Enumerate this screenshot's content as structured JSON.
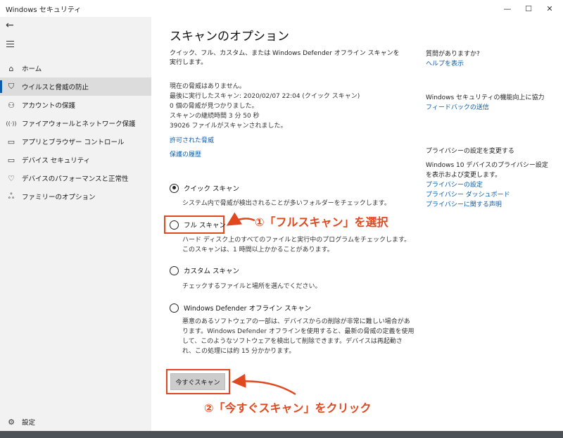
{
  "window": {
    "title": "Windows セキュリティ"
  },
  "titlebar_controls": {
    "minimize": "—",
    "maximize": "☐",
    "close": "✕"
  },
  "sidebar": {
    "back_icon": "←",
    "items": [
      {
        "icon": "⌂",
        "label": "ホーム"
      },
      {
        "icon": "⛉",
        "label": "ウイルスと脅威の防止"
      },
      {
        "icon": "⚇",
        "label": "アカウントの保護"
      },
      {
        "icon": "((·))",
        "label": "ファイアウォールとネットワーク保護"
      },
      {
        "icon": "▭",
        "label": "アプリとブラウザー コントロール"
      },
      {
        "icon": "▭",
        "label": "デバイス セキュリティ"
      },
      {
        "icon": "♡",
        "label": "デバイスのパフォーマンスと正常性"
      },
      {
        "icon": "ஃ",
        "label": "ファミリーのオプション"
      }
    ],
    "settings": {
      "icon": "⚙",
      "label": "設定"
    }
  },
  "main": {
    "title": "スキャンのオプション",
    "description": "クイック、フル、カスタム、または Windows Defender オフライン スキャンを実行します。",
    "status_lines": [
      "現在の脅威はありません。",
      "最後に実行したスキャン: 2020/02/07 22:04 (クイック スキャン)",
      "0 個の脅威が見つかりました。",
      "スキャンの継続時間 3 分 50 秒",
      "39026 ファイルがスキャンされました。"
    ],
    "allowed_threats_link": "許可された脅威",
    "history_link": "保護の履歴",
    "options": [
      {
        "label": "クイック スキャン",
        "selected": true,
        "desc": "システム内で脅威が検出されることが多いフォルダーをチェックします。"
      },
      {
        "label": "フル スキャン",
        "selected": false,
        "desc": "ハード ディスク上のすべてのファイルと実行中のプログラムをチェックします。このスキャンは、1 時間以上かかることがあります。"
      },
      {
        "label": "カスタム スキャン",
        "selected": false,
        "desc": "チェックするファイルと場所を選んでください。"
      },
      {
        "label": "Windows Defender オフライン スキャン",
        "selected": false,
        "desc": "悪意のあるソフトウェアの一部は、デバイスからの削除が非常に難しい場合があります。Windows Defender オフラインを使用すると、最新の脅威の定義を使用して、このようなソフトウェアを検出して削除できます。デバイスは再起動され、この処理には約 15 分かかります。"
      }
    ],
    "scan_button": "今すぐスキャン"
  },
  "annotations": {
    "step1": "①「フルスキャン」を選択",
    "step2": "②「今すぐスキャン」をクリック",
    "color": "#e0491f"
  },
  "right_column": {
    "questions_heading": "質問がありますか?",
    "help_link": "ヘルプを表示",
    "improve_heading": "Windows セキュリティの機能向上に協力",
    "feedback_link": "フィードバックの送信",
    "privacy_heading": "プライバシーの設定を変更する",
    "privacy_text": "Windows 10 デバイスのプライバシー設定を表示および変更します。",
    "privacy_links": [
      "プライバシーの設定",
      "プライバシー ダッシュボード",
      "プライバシーに関する声明"
    ]
  }
}
